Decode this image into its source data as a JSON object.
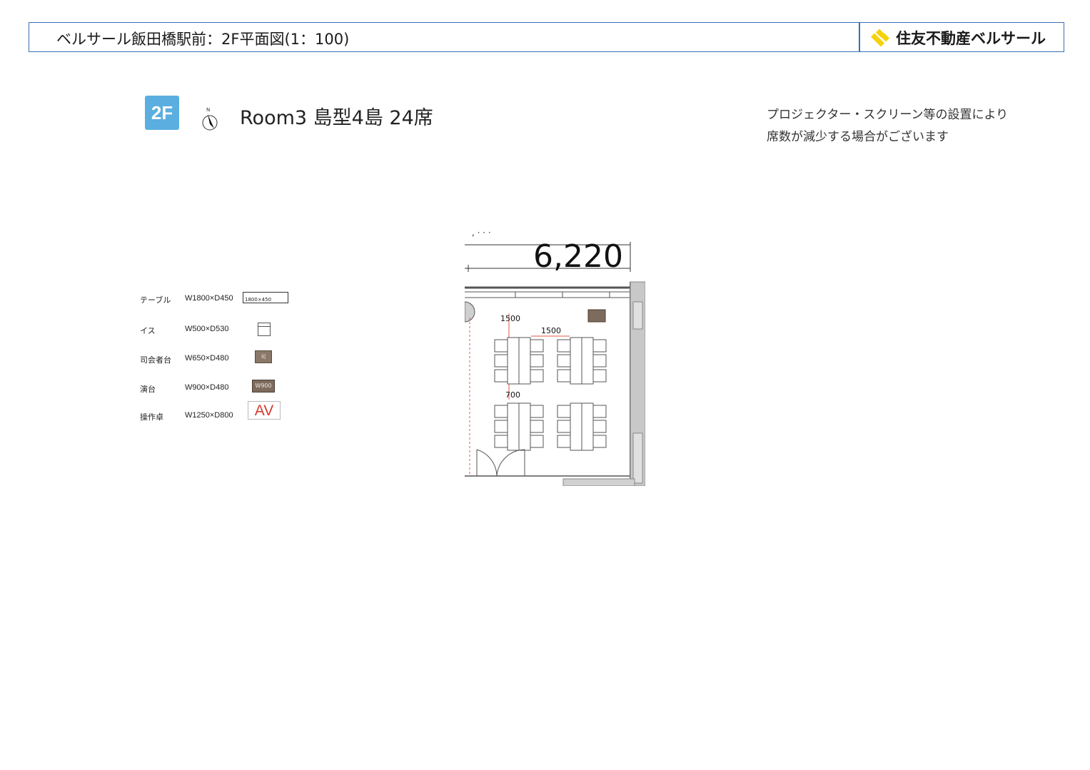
{
  "header": {
    "title": "ベルサール飯田橋駅前：2F平面図(1：100)",
    "brand_name": "住友不動産ベルサール",
    "brand_color": "#f5d20a",
    "border_color": "#3a6fb5"
  },
  "room": {
    "floor_badge": "2F",
    "floor_badge_color": "#5aaee0",
    "compass_label": "N",
    "title": "Room3 島型4島 24席"
  },
  "note": {
    "line1": "プロジェクター・スクリーン等の設置により",
    "line2": "席数が減少する場合がございます"
  },
  "legend": [
    {
      "name": "テーブル",
      "dims": "W1800×D450",
      "symbol_text": "1800×450",
      "icon": "table-symbol"
    },
    {
      "name": "イス",
      "dims": "W500×D530",
      "symbol_text": "",
      "icon": "chair-symbol"
    },
    {
      "name": "司会者台",
      "dims": "W650×D480",
      "symbol_text": "司",
      "icon": "mc-stand-symbol"
    },
    {
      "name": "演台",
      "dims": "W900×D480",
      "symbol_text": "W900",
      "icon": "podium-symbol"
    },
    {
      "name": "操作卓",
      "dims": "W1250×D800",
      "symbol_text": "AV",
      "icon": "av-console-symbol"
    }
  ],
  "plan": {
    "width_dimension": "6,220",
    "spacing_vertical": "1500",
    "spacing_horizontal": "1500",
    "spacing_row": "700",
    "islands": 4,
    "seats": 24
  }
}
